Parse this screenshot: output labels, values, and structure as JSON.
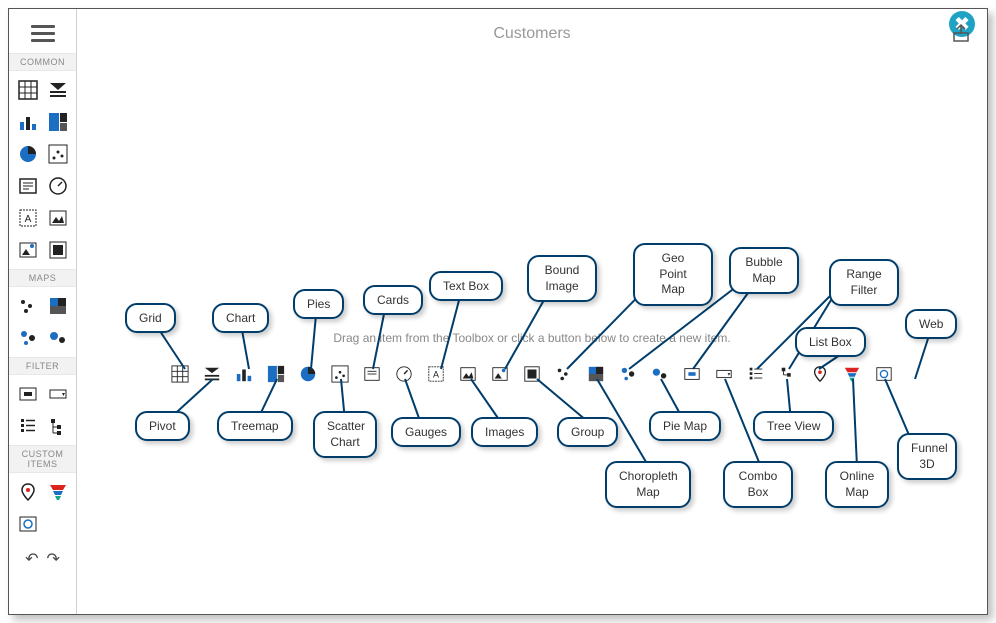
{
  "close_label": "✖",
  "header": {
    "title": "Customers"
  },
  "hint": "Drag an item from the Toolbox or click a button below to create a new item.",
  "sidebar": {
    "sections": {
      "common": "COMMON",
      "maps": "MAPS",
      "filter": "FILTER",
      "custom": "CUSTOM ITEMS"
    }
  },
  "callouts": {
    "grid": "Grid",
    "pivot": "Pivot",
    "chart": "Chart",
    "treemap": "Treemap",
    "pies": "Pies",
    "scatter": "Scatter\nChart",
    "cards": "Cards",
    "gauges": "Gauges",
    "textbox": "Text Box",
    "images": "Images",
    "bound": "Bound\nImage",
    "group": "Group",
    "geopoint": "Geo Point\nMap",
    "choropleth": "Choropleth\nMap",
    "piemap": "Pie Map",
    "bubble": "Bubble\nMap",
    "combobox": "Combo\nBox",
    "treeview": "Tree View",
    "listbox": "List Box",
    "range": "Range\nFilter",
    "onlinemap": "Online\nMap",
    "funnel": "Funnel\n3D",
    "web": "Web"
  },
  "strip_items": [
    "grid",
    "pivot",
    "chart",
    "treemap",
    "pies",
    "scatter",
    "cards",
    "gauges",
    "textbox",
    "images",
    "bound",
    "group",
    "geopoint",
    "choropleth",
    "piemap",
    "bubble",
    "combobox",
    "treeview",
    "listbox",
    "range",
    "onlinemap",
    "funnel",
    "web"
  ]
}
